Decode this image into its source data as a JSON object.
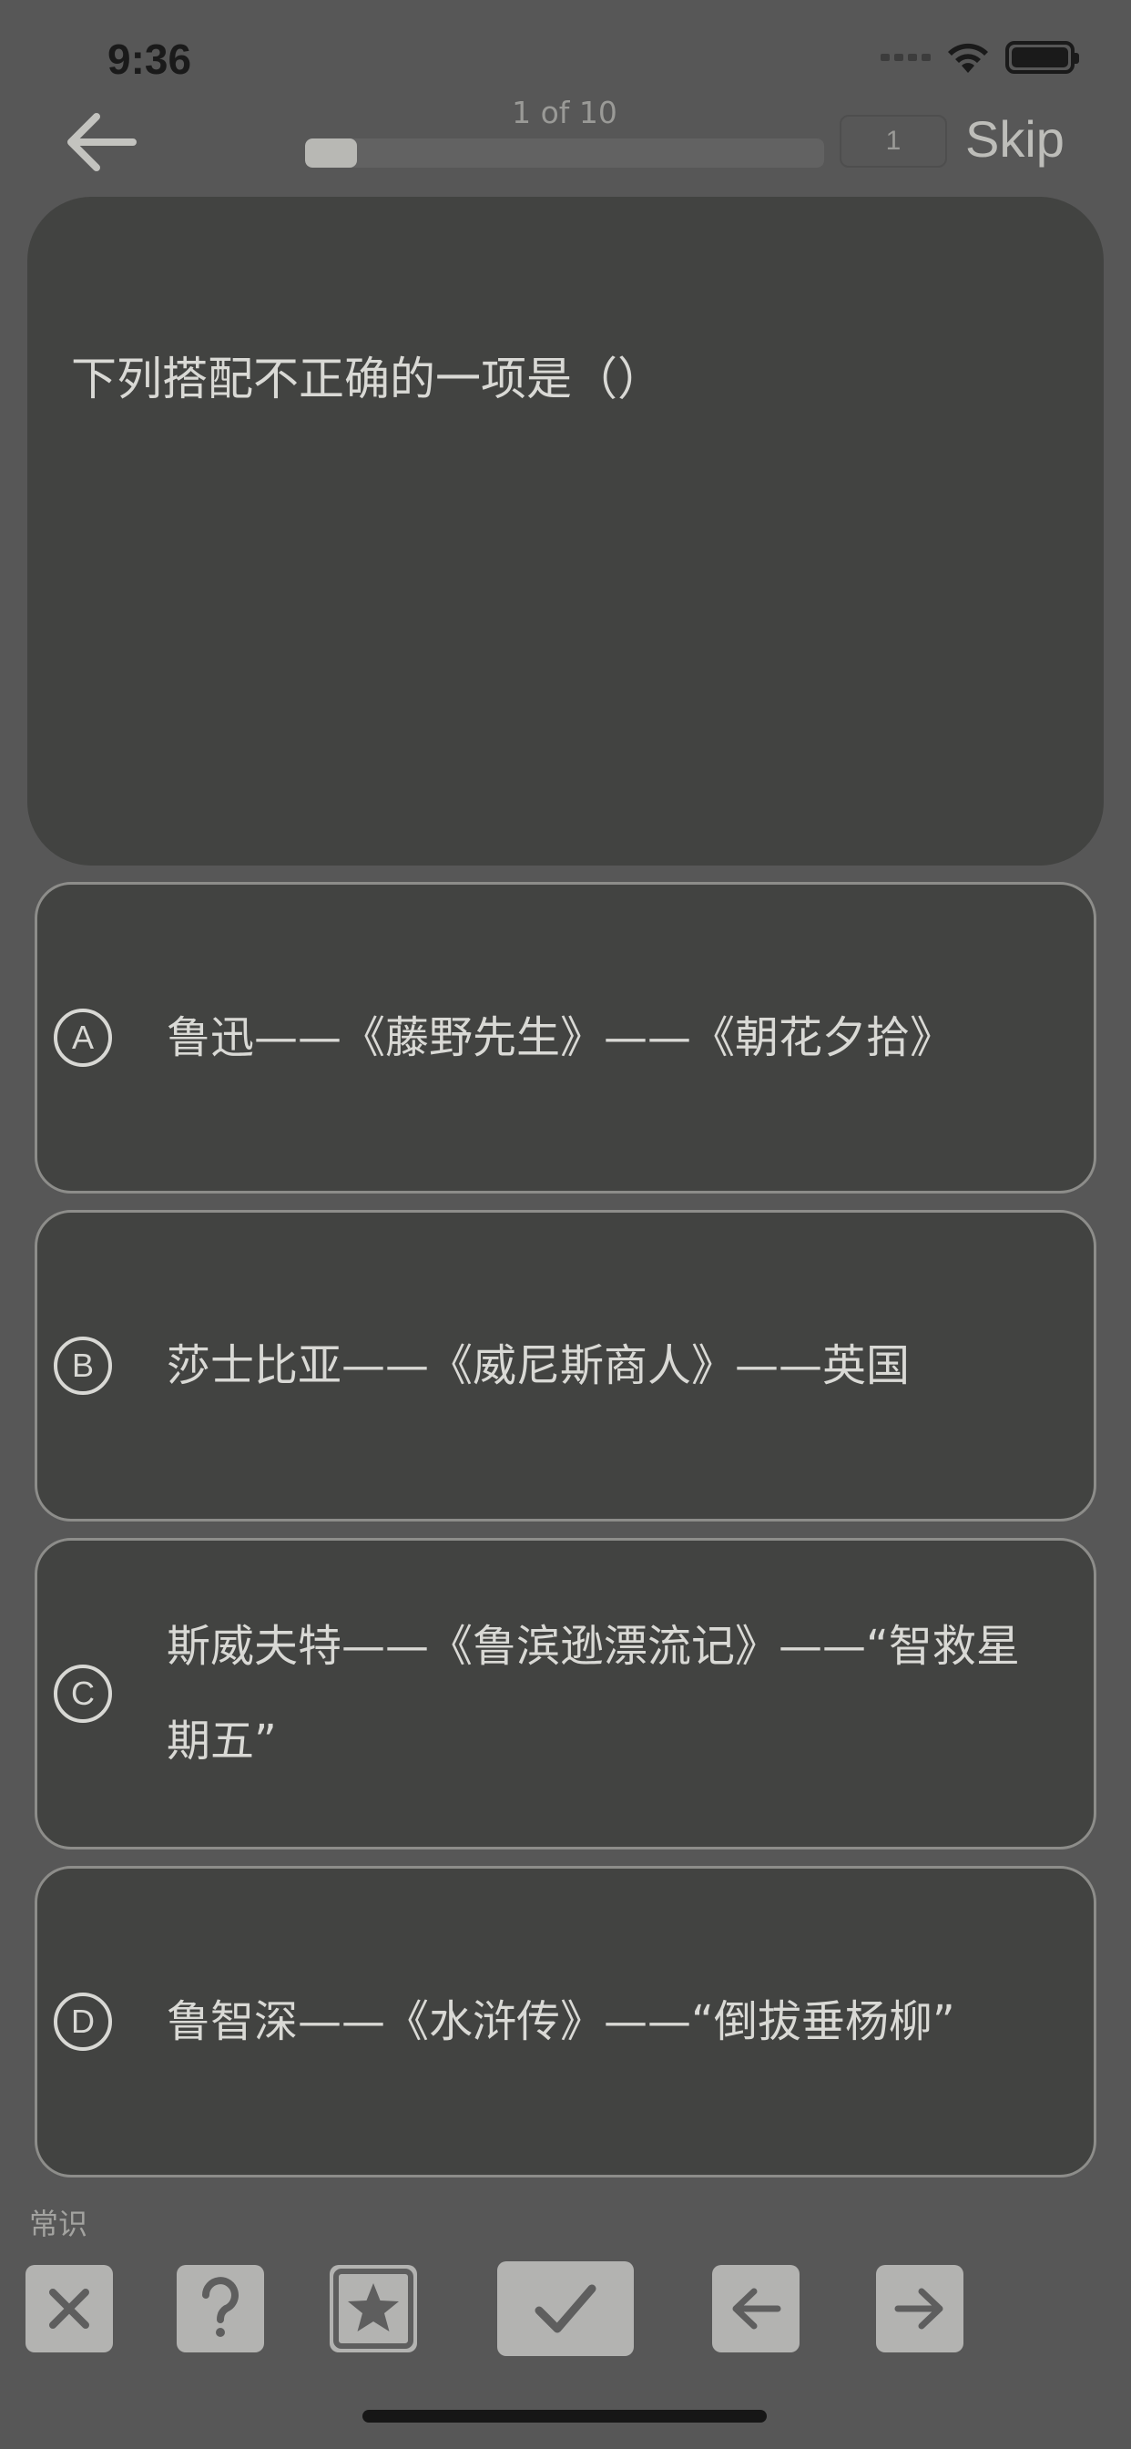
{
  "status": {
    "time": "9:36"
  },
  "nav": {
    "progress_label": "1 of 10",
    "progress_fraction": 0.1,
    "page_value": "1",
    "skip_label": "Skip"
  },
  "question": {
    "text": "下列搭配不正确的一项是（）"
  },
  "options": [
    {
      "letter": "A",
      "text": "鲁迅——《藤野先生》——《朝花夕拾》"
    },
    {
      "letter": "B",
      "text": "莎士比亚——《威尼斯商人》——英国"
    },
    {
      "letter": "C",
      "text": "斯威夫特——《鲁滨逊漂流记》——“智救星期五”"
    },
    {
      "letter": "D",
      "text": "鲁智深——《水浒传》——“倒拔垂杨柳”"
    }
  ],
  "category": "常识",
  "toolbar": {
    "icons": [
      "close-icon",
      "question-icon",
      "star-icon",
      "check-icon",
      "arrow-left-icon",
      "arrow-right-icon"
    ]
  },
  "colors": {
    "background": "#575757",
    "card": "#424341",
    "button": "#b3b3b1",
    "icon": "#5e5e5e"
  }
}
